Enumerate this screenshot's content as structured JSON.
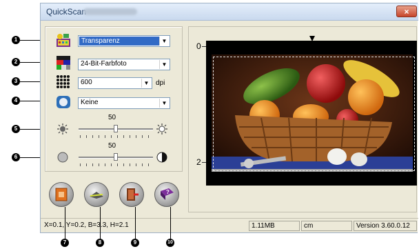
{
  "window": {
    "title": "QuickScan",
    "close_label": "×"
  },
  "settings": {
    "scan_type": "Transparenz",
    "color_mode": "24-Bit-Farbfoto",
    "resolution": "600",
    "resolution_unit": "dpi",
    "filter": "Keine",
    "brightness_value": "50",
    "contrast_value": "50"
  },
  "preview": {
    "ruler_top": "0",
    "ruler_bottom": "2"
  },
  "status_bar": {
    "coords": "X=0.1, Y=0.2, B=3.3, H=2.1",
    "size": "1.11MB",
    "unit": "cm",
    "version": "Version 3.60.0.12"
  },
  "callouts": [
    "1",
    "2",
    "3",
    "4",
    "5",
    "6",
    "7",
    "8",
    "9",
    "10"
  ]
}
